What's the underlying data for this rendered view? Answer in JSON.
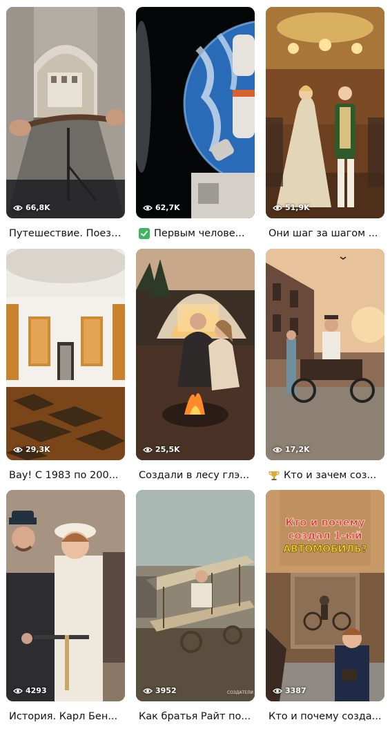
{
  "videos": [
    {
      "views": "66,8K",
      "title": "Путешествие. Поезд...",
      "emoji": ""
    },
    {
      "views": "62,7K",
      "title": "Первым челове...",
      "emoji": "check-mark-icon"
    },
    {
      "views": "51,9K",
      "title": "Они шаг за шагом ...",
      "emoji": ""
    },
    {
      "views": "29,3K",
      "title": "Вау! С 1983 по 200...",
      "emoji": ""
    },
    {
      "views": "25,5K",
      "title": "Создали в лесу глэ...",
      "emoji": ""
    },
    {
      "views": "17,2K",
      "title": "Кто и зачем соз...",
      "emoji": "trophy-icon"
    },
    {
      "views": "4293",
      "title": "История. Карл Бен...",
      "emoji": ""
    },
    {
      "views": "3952",
      "title": "Как братья Райт по...",
      "emoji": ""
    },
    {
      "views": "3387",
      "title": "Кто и почему созда...",
      "emoji": ""
    }
  ],
  "thumb_overlay": {
    "line1": "Кто и почему",
    "line2": "создал 1-ый",
    "line3": "АВТОМОБИЛЬ?",
    "watermark": "СОЗДАТЕЛИ"
  }
}
